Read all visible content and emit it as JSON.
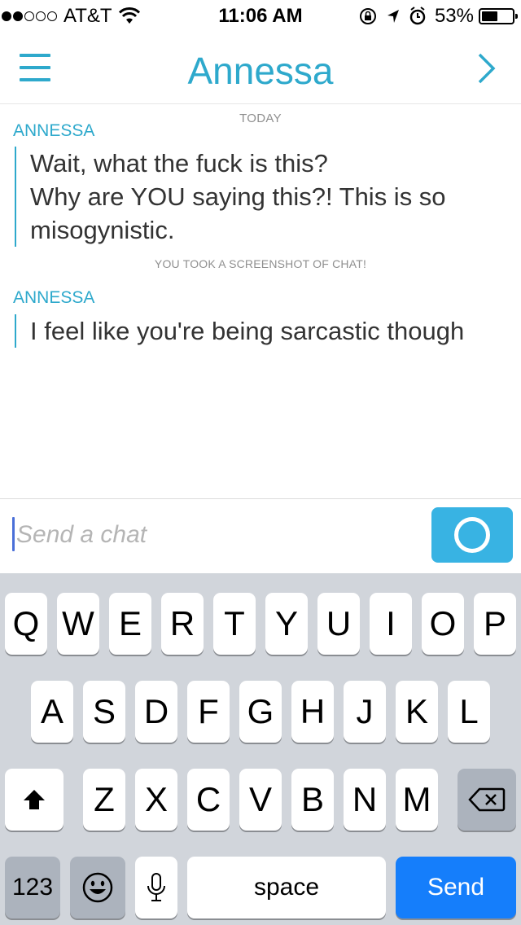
{
  "status_bar": {
    "carrier": "AT&T",
    "time": "11:06 AM",
    "battery_percent": "53%",
    "battery_level": 0.53,
    "icons": [
      "signal-dots",
      "wifi-icon",
      "rotation-lock-icon",
      "location-arrow-icon",
      "alarm-icon",
      "battery-icon"
    ]
  },
  "header": {
    "title": "Annessa",
    "left_icon": "hamburger-menu-icon",
    "right_icon": "chevron-right-icon"
  },
  "chat": {
    "date_label": "TODAY",
    "messages": [
      {
        "sender": "ANNESSA",
        "lines": [
          "Wait, what the fuck is this?",
          "Why are YOU saying this?! This is so",
          "misogynistic."
        ]
      },
      {
        "sender": "ANNESSA",
        "lines": [
          "I feel like you're being sarcastic though"
        ]
      }
    ],
    "system_note": "YOU TOOK A SCREENSHOT OF CHAT!"
  },
  "input": {
    "placeholder": "Send a chat",
    "value": "",
    "camera_icon": "camera-circle-icon"
  },
  "keyboard": {
    "row1": [
      "Q",
      "W",
      "E",
      "R",
      "T",
      "Y",
      "U",
      "I",
      "O",
      "P"
    ],
    "row2": [
      "A",
      "S",
      "D",
      "F",
      "G",
      "H",
      "J",
      "K",
      "L"
    ],
    "row3": [
      "Z",
      "X",
      "C",
      "V",
      "B",
      "N",
      "M"
    ],
    "numbers_label": "123",
    "space_label": "space",
    "send_label": "Send",
    "shift_icon": "shift-arrow-icon",
    "delete_icon": "backspace-icon",
    "emoji_icon": "emoji-icon",
    "mic_icon": "microphone-icon"
  },
  "colors": {
    "accent": "#2ea9cc",
    "camera_button": "#38b3e3",
    "send_key": "#157efb",
    "keyboard_bg": "#d1d5db"
  }
}
